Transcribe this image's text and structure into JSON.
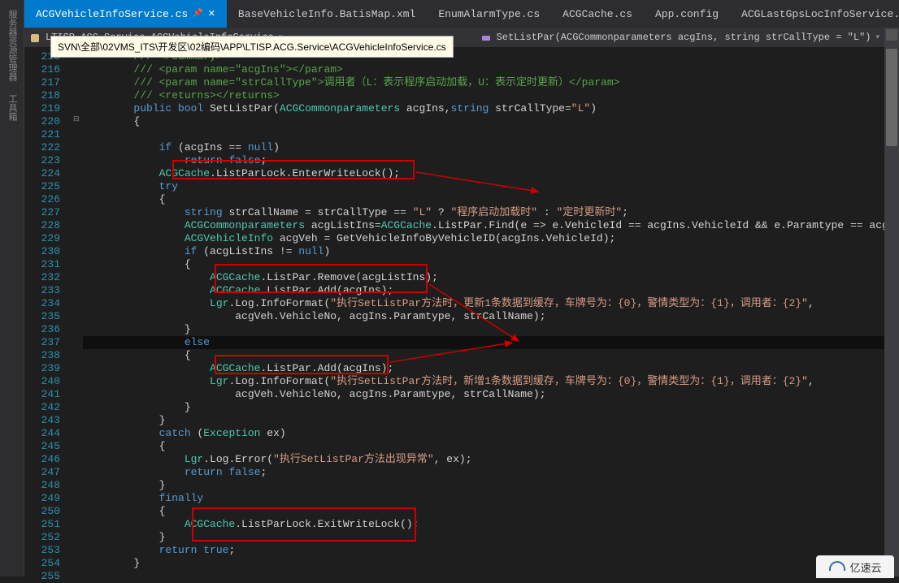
{
  "sidebar": {
    "items": [
      {
        "label": "服务器资源管理器"
      },
      {
        "label": "工具箱"
      }
    ]
  },
  "tabs": [
    {
      "label": "ACGVehicleInfoService.cs",
      "active": true,
      "pinned": true,
      "closeable": true
    },
    {
      "label": "BaseVehicleInfo.BatisMap.xml",
      "active": false
    },
    {
      "label": "EnumAlarmType.cs",
      "active": false
    },
    {
      "label": "ACGCache.cs",
      "active": false
    },
    {
      "label": "App.config",
      "active": false
    },
    {
      "label": "ACGLastGpsLocInfoService.cs",
      "active": false
    }
  ],
  "breadcrumb": {
    "left": "LTISP.ACG.Service.ACGVehicleInfoService",
    "right": "SetListPar(ACGCommonparameters acgIns, string strCallType = \"L\")"
  },
  "tooltip": "SVN\\全部\\02VMS_ITS\\开发区\\02编码\\APP\\LTISP.ACG.Service\\ACGVehicleInfoService.cs",
  "codeStartLine": 215,
  "code": [
    {
      "n": 215,
      "seg": [
        [
          "c-comment",
          "        /// </summary>"
        ]
      ]
    },
    {
      "n": 216,
      "seg": [
        [
          "c-comment",
          "        /// <param name=\"acgIns\"></param>"
        ]
      ]
    },
    {
      "n": 217,
      "seg": [
        [
          "c-comment",
          "        /// <param name=\"strCallType\">调用者（L：表示程序启动加载，U：表示定时更新）</param>"
        ]
      ]
    },
    {
      "n": 218,
      "seg": [
        [
          "c-comment",
          "        /// <returns></returns>"
        ]
      ]
    },
    {
      "n": 219,
      "seg": [
        [
          "c-plain",
          "        "
        ],
        [
          "c-key",
          "public"
        ],
        [
          "c-plain",
          " "
        ],
        [
          "c-key",
          "bool"
        ],
        [
          "c-plain",
          " SetListPar("
        ],
        [
          "c-type",
          "ACGCommonparameters"
        ],
        [
          "c-plain",
          " acgIns,"
        ],
        [
          "c-key",
          "string"
        ],
        [
          "c-plain",
          " strCallType="
        ],
        [
          "c-str",
          "\"L\""
        ],
        [
          "c-plain",
          ")"
        ]
      ]
    },
    {
      "n": 220,
      "seg": [
        [
          "c-plain",
          "        {"
        ]
      ]
    },
    {
      "n": 221,
      "seg": [
        [
          "c-plain",
          ""
        ]
      ]
    },
    {
      "n": 222,
      "seg": [
        [
          "c-plain",
          "            "
        ],
        [
          "c-key",
          "if"
        ],
        [
          "c-plain",
          " (acgIns == "
        ],
        [
          "c-null",
          "null"
        ],
        [
          "c-plain",
          ")"
        ]
      ]
    },
    {
      "n": 223,
      "seg": [
        [
          "c-plain",
          "                "
        ],
        [
          "c-key",
          "return"
        ],
        [
          "c-plain",
          " "
        ],
        [
          "c-key",
          "false"
        ],
        [
          "c-plain",
          ";"
        ]
      ]
    },
    {
      "n": 224,
      "seg": [
        [
          "c-plain",
          "            "
        ],
        [
          "c-type",
          "ACGCache"
        ],
        [
          "c-plain",
          ".ListParLock.EnterWriteLock();"
        ]
      ]
    },
    {
      "n": 225,
      "seg": [
        [
          "c-plain",
          "            "
        ],
        [
          "c-key",
          "try"
        ]
      ]
    },
    {
      "n": 226,
      "seg": [
        [
          "c-plain",
          "            {"
        ]
      ]
    },
    {
      "n": 227,
      "seg": [
        [
          "c-plain",
          "                "
        ],
        [
          "c-key",
          "string"
        ],
        [
          "c-plain",
          " strCallName = strCallType == "
        ],
        [
          "c-str",
          "\"L\""
        ],
        [
          "c-plain",
          " ? "
        ],
        [
          "c-str",
          "\"程序启动加载时\""
        ],
        [
          "c-plain",
          " : "
        ],
        [
          "c-str",
          "\"定时更新时\""
        ],
        [
          "c-plain",
          ";"
        ]
      ]
    },
    {
      "n": 228,
      "seg": [
        [
          "c-plain",
          "                "
        ],
        [
          "c-type",
          "ACGCommonparameters"
        ],
        [
          "c-plain",
          " acgListIns="
        ],
        [
          "c-type",
          "ACGCache"
        ],
        [
          "c-plain",
          ".ListPar.Find(e => e.VehicleId == acgIns.VehicleId && e.Paramtype == acgIns.Paramtype)"
        ]
      ]
    },
    {
      "n": 229,
      "seg": [
        [
          "c-plain",
          "                "
        ],
        [
          "c-type",
          "ACGVehicleInfo"
        ],
        [
          "c-plain",
          " acgVeh = GetVehicleInfoByVehicleID(acgIns.VehicleId);"
        ]
      ]
    },
    {
      "n": 230,
      "seg": [
        [
          "c-plain",
          "                "
        ],
        [
          "c-key",
          "if"
        ],
        [
          "c-plain",
          " (acgListIns != "
        ],
        [
          "c-null",
          "null"
        ],
        [
          "c-plain",
          ")"
        ]
      ]
    },
    {
      "n": 231,
      "seg": [
        [
          "c-plain",
          "                {"
        ]
      ]
    },
    {
      "n": 232,
      "seg": [
        [
          "c-plain",
          "                    "
        ],
        [
          "c-type",
          "ACGCache"
        ],
        [
          "c-plain",
          ".ListPar.Remove(acgListIns);"
        ]
      ]
    },
    {
      "n": 233,
      "seg": [
        [
          "c-plain",
          "                    "
        ],
        [
          "c-type",
          "ACGCache"
        ],
        [
          "c-plain",
          ".ListPar.Add(acgIns);"
        ]
      ]
    },
    {
      "n": 234,
      "seg": [
        [
          "c-plain",
          "                    "
        ],
        [
          "c-type",
          "Lgr"
        ],
        [
          "c-plain",
          ".Log.InfoFormat("
        ],
        [
          "c-str",
          "\"执行SetListPar方法时，更新1条数据到缓存，车牌号为：{0}，警情类型为：{1}，调用者：{2}\""
        ],
        [
          "c-plain",
          ","
        ]
      ]
    },
    {
      "n": 235,
      "seg": [
        [
          "c-plain",
          "                        acgVeh.VehicleNo, acgIns.Paramtype, strCallName);"
        ]
      ]
    },
    {
      "n": 236,
      "seg": [
        [
          "c-plain",
          "                }"
        ]
      ]
    },
    {
      "n": 237,
      "seg": [
        [
          "c-plain",
          "                "
        ],
        [
          "c-key",
          "else"
        ]
      ],
      "hl": true
    },
    {
      "n": 238,
      "seg": [
        [
          "c-plain",
          "                {"
        ]
      ]
    },
    {
      "n": 239,
      "seg": [
        [
          "c-plain",
          "                    "
        ],
        [
          "c-type",
          "ACGCache"
        ],
        [
          "c-plain",
          ".ListPar.Add(acgIns);"
        ]
      ]
    },
    {
      "n": 240,
      "seg": [
        [
          "c-plain",
          "                    "
        ],
        [
          "c-type",
          "Lgr"
        ],
        [
          "c-plain",
          ".Log.InfoFormat("
        ],
        [
          "c-str",
          "\"执行SetListPar方法时，新增1条数据到缓存，车牌号为：{0}，警情类型为：{1}，调用者：{2}\""
        ],
        [
          "c-plain",
          ","
        ]
      ]
    },
    {
      "n": 241,
      "seg": [
        [
          "c-plain",
          "                        acgVeh.VehicleNo, acgIns.Paramtype, strCallName);"
        ]
      ]
    },
    {
      "n": 242,
      "seg": [
        [
          "c-plain",
          "                }"
        ]
      ]
    },
    {
      "n": 243,
      "seg": [
        [
          "c-plain",
          "            }"
        ]
      ]
    },
    {
      "n": 244,
      "seg": [
        [
          "c-plain",
          "            "
        ],
        [
          "c-key",
          "catch"
        ],
        [
          "c-plain",
          " ("
        ],
        [
          "c-type",
          "Exception"
        ],
        [
          "c-plain",
          " ex)"
        ]
      ]
    },
    {
      "n": 245,
      "seg": [
        [
          "c-plain",
          "            {"
        ]
      ]
    },
    {
      "n": 246,
      "seg": [
        [
          "c-plain",
          "                "
        ],
        [
          "c-type",
          "Lgr"
        ],
        [
          "c-plain",
          ".Log.Error("
        ],
        [
          "c-str",
          "\"执行SetListPar方法出现异常\""
        ],
        [
          "c-plain",
          ", ex);"
        ]
      ]
    },
    {
      "n": 247,
      "seg": [
        [
          "c-plain",
          "                "
        ],
        [
          "c-key",
          "return"
        ],
        [
          "c-plain",
          " "
        ],
        [
          "c-key",
          "false"
        ],
        [
          "c-plain",
          ";"
        ]
      ]
    },
    {
      "n": 248,
      "seg": [
        [
          "c-plain",
          "            }"
        ]
      ]
    },
    {
      "n": 249,
      "seg": [
        [
          "c-plain",
          "            "
        ],
        [
          "c-key",
          "finally"
        ]
      ]
    },
    {
      "n": 250,
      "seg": [
        [
          "c-plain",
          "            {"
        ]
      ]
    },
    {
      "n": 251,
      "seg": [
        [
          "c-plain",
          "                "
        ],
        [
          "c-type",
          "ACGCache"
        ],
        [
          "c-plain",
          ".ListParLock.ExitWriteLock();"
        ]
      ]
    },
    {
      "n": 252,
      "seg": [
        [
          "c-plain",
          "            }"
        ]
      ]
    },
    {
      "n": 253,
      "seg": [
        [
          "c-plain",
          "            "
        ],
        [
          "c-key",
          "return"
        ],
        [
          "c-plain",
          " "
        ],
        [
          "c-key",
          "true"
        ],
        [
          "c-plain",
          ";"
        ]
      ]
    },
    {
      "n": 254,
      "seg": [
        [
          "c-plain",
          "        }"
        ]
      ]
    },
    {
      "n": 255,
      "seg": [
        [
          "c-plain",
          ""
        ]
      ]
    }
  ],
  "watermark": "亿速云"
}
